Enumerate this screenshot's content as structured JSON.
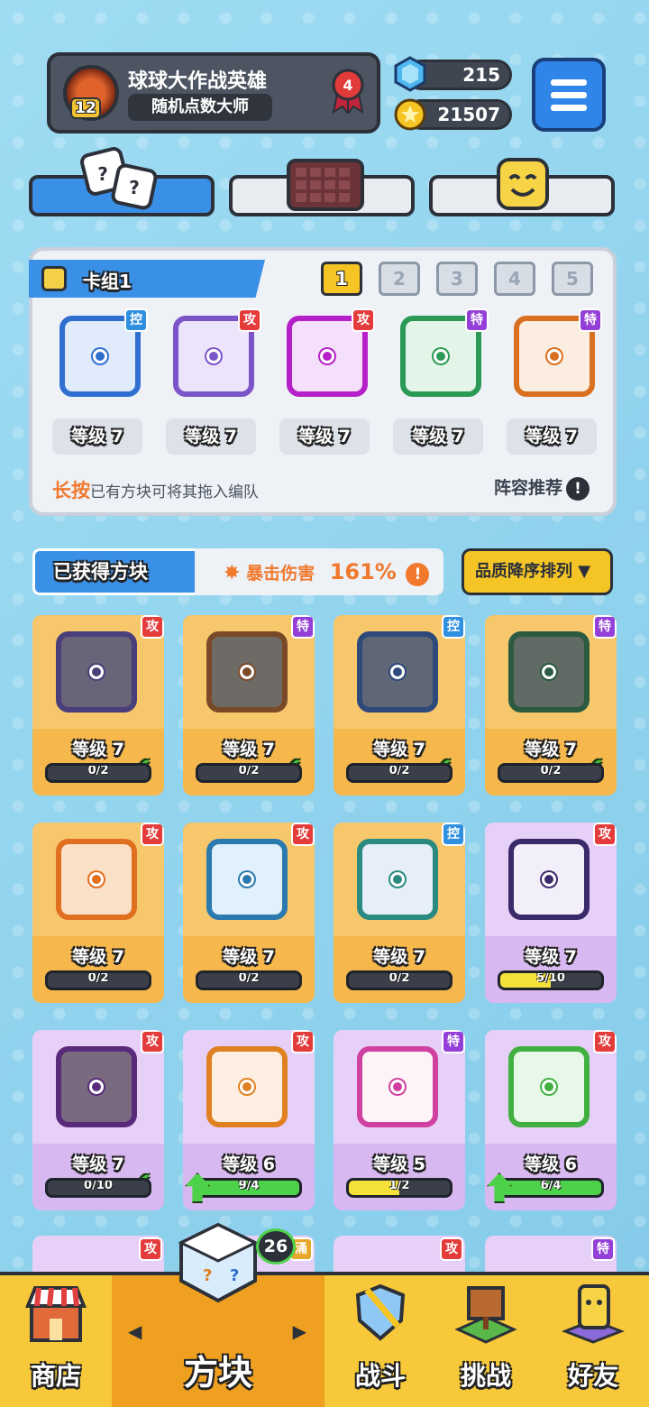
{
  "profile": {
    "name": "球球大作战英雄",
    "title": "随机点数大师",
    "level": "12",
    "rank": "4"
  },
  "currency": {
    "gems": "215",
    "coins": "21507"
  },
  "deck": {
    "name": "卡组1",
    "slots": [
      "1",
      "2",
      "3",
      "4",
      "5"
    ],
    "active_slot": "1",
    "cards": [
      {
        "tag": "控",
        "tagtype": "k",
        "level": "等级 7",
        "border": "#2f6fd0",
        "bg": "#e0ebfb"
      },
      {
        "tag": "攻",
        "tagtype": "a",
        "level": "等级 7",
        "border": "#7b55c8",
        "bg": "#ece4fa"
      },
      {
        "tag": "攻",
        "tagtype": "a",
        "level": "等级 7",
        "border": "#b520c8",
        "bg": "#f5e0fb"
      },
      {
        "tag": "特",
        "tagtype": "t",
        "level": "等级 7",
        "border": "#2a9a55",
        "bg": "#e2f5e8"
      },
      {
        "tag": "特",
        "tagtype": "t",
        "level": "等级 7",
        "border": "#d87020",
        "bg": "#fbeee0"
      }
    ],
    "hint_bold": "长按",
    "hint_rest": "已有方块可将其拖入编队",
    "recommend": "阵容推荐"
  },
  "obtained": {
    "title": "已获得方块",
    "crit_label": "暴击伤害",
    "crit_value": "161%",
    "sort": "品质降序排列 ▼"
  },
  "grid": [
    {
      "tag": "攻",
      "tagtype": "a",
      "level": "等级 7",
      "progress": "0/2",
      "fill": 0,
      "theme": "gold",
      "border": "#4a3f7a",
      "bg": "#6a6478",
      "check": true
    },
    {
      "tag": "特",
      "tagtype": "t",
      "level": "等级 7",
      "progress": "0/2",
      "fill": 0,
      "theme": "gold",
      "border": "#7a4a28",
      "bg": "#6e6a66",
      "check": true
    },
    {
      "tag": "控",
      "tagtype": "k",
      "level": "等级 7",
      "progress": "0/2",
      "fill": 0,
      "theme": "gold",
      "border": "#2e4a7a",
      "bg": "#5f6676",
      "check": true
    },
    {
      "tag": "特",
      "tagtype": "t",
      "level": "等级 7",
      "progress": "0/2",
      "fill": 0,
      "theme": "gold",
      "border": "#2a5a40",
      "bg": "#5f6b64",
      "check": true
    },
    {
      "tag": "攻",
      "tagtype": "a",
      "level": "等级 7",
      "progress": "0/2",
      "fill": 0,
      "theme": "gold",
      "border": "#e07020",
      "bg": "#fbe0c8",
      "check": false
    },
    {
      "tag": "攻",
      "tagtype": "a",
      "level": "等级 7",
      "progress": "0/2",
      "fill": 0,
      "theme": "gold",
      "border": "#2a7ab0",
      "bg": "#e0f1fb",
      "check": false
    },
    {
      "tag": "控",
      "tagtype": "k",
      "level": "等级 7",
      "progress": "0/2",
      "fill": 0,
      "theme": "gold",
      "border": "#2a8a80",
      "bg": "#e6eef8",
      "check": false
    },
    {
      "tag": "攻",
      "tagtype": "a",
      "level": "等级 7",
      "progress": "5/10",
      "fill": 0.5,
      "theme": "purple",
      "border": "#3a2a6a",
      "bg": "#f2eefa",
      "check": false
    },
    {
      "tag": "攻",
      "tagtype": "a",
      "level": "等级 7",
      "progress": "0/10",
      "fill": 0,
      "theme": "purple",
      "border": "#5a2a7a",
      "bg": "#7a6a80",
      "check": true
    },
    {
      "tag": "攻",
      "tagtype": "a",
      "level": "等级 6",
      "progress": "9/4",
      "fill": 1,
      "theme": "purple",
      "border": "#e08020",
      "bg": "#fcefe2",
      "check": false,
      "upgrade": true
    },
    {
      "tag": "特",
      "tagtype": "t",
      "level": "等级 5",
      "progress": "1/2",
      "fill": 0.5,
      "theme": "purple",
      "border": "#d040a0",
      "bg": "#fdf4f8",
      "check": false
    },
    {
      "tag": "攻",
      "tagtype": "a",
      "level": "等级 6",
      "progress": "6/4",
      "fill": 1,
      "theme": "purple",
      "border": "#40b040",
      "bg": "#e8f8e8",
      "check": false,
      "upgrade": true
    }
  ],
  "nav": {
    "shop": "商店",
    "blocks": "方块",
    "battle": "战斗",
    "challenge": "挑战",
    "friends": "好友",
    "blocks_badge": "26",
    "badge_tag": "涌"
  },
  "partial_tags": [
    "攻",
    "涌",
    "攻",
    "特"
  ],
  "icons": {
    "gem": "gem-icon",
    "coin": "coin-icon",
    "menu": "hamburger-menu-icon",
    "edit": "pencil-icon"
  }
}
